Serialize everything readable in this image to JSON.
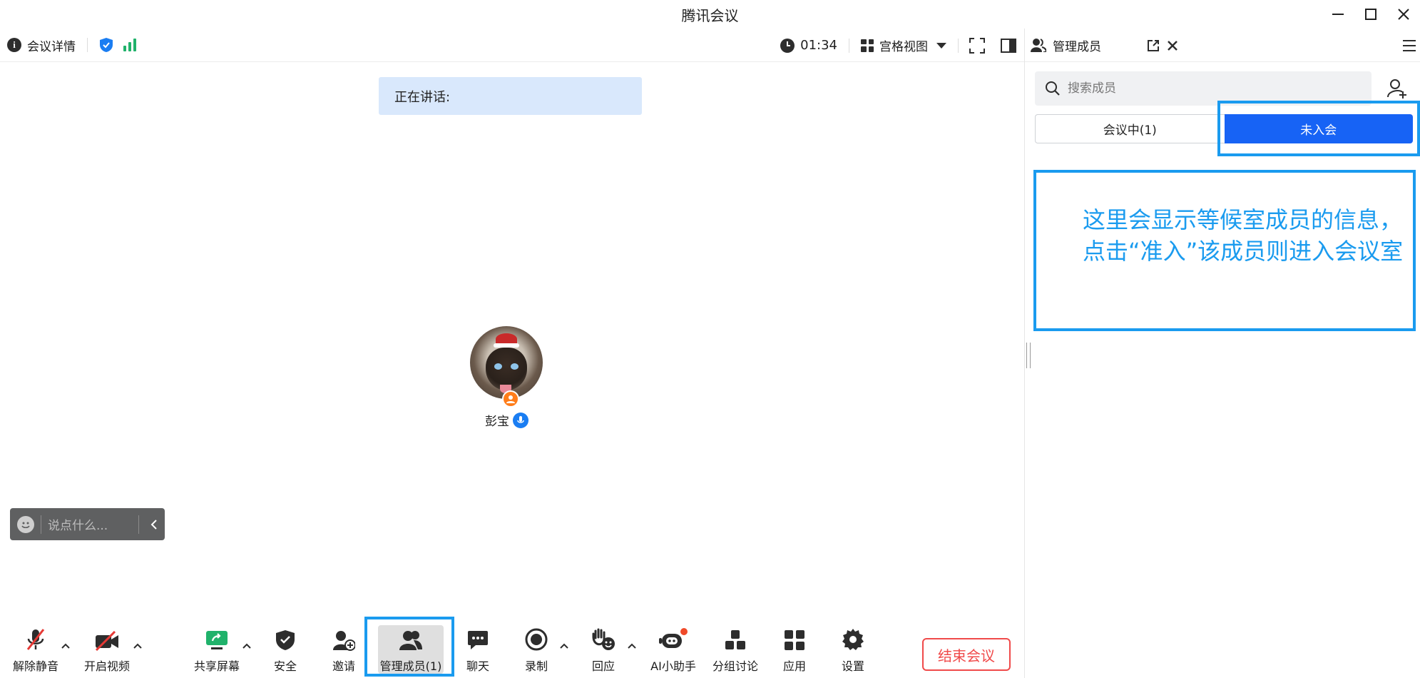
{
  "window": {
    "title": "腾讯会议"
  },
  "topbar": {
    "meeting_details": "会议详情",
    "timer": "01:34",
    "view_mode": "宫格视图"
  },
  "stage": {
    "speaking_label": "正在讲话:",
    "participant_name": "彭宝"
  },
  "chat": {
    "placeholder": "说点什么..."
  },
  "toolbar": {
    "unmute": "解除静音",
    "start_video": "开启视频",
    "share_screen": "共享屏幕",
    "security": "安全",
    "invite": "邀请",
    "manage_members": "管理成员(1)",
    "chat": "聊天",
    "record": "录制",
    "react": "回应",
    "ai_assistant": "AI小助手",
    "breakout": "分组讨论",
    "apps": "应用",
    "settings": "设置",
    "end_meeting": "结束会议"
  },
  "panel": {
    "title": "管理成员",
    "search_placeholder": "搜索成员",
    "tab_in_meeting": "会议中(1)",
    "tab_not_joined": "未入会",
    "annotation": "这里会显示等候室成员的信息，点击“准入”该成员则进入会议室"
  },
  "colors": {
    "accent": "#1763f5",
    "annotation": "#1a9bef",
    "end": "#f04a4a",
    "signal": "#20b26b"
  },
  "icons": [
    "info-icon",
    "shield-icon",
    "signal-icon",
    "clock-icon",
    "grid-view-icon",
    "fullscreen-icon",
    "sidebar-icon",
    "members-icon",
    "popout-icon",
    "close-icon",
    "menu-icon",
    "search-icon",
    "add-member-icon",
    "mic-off-icon",
    "video-off-icon",
    "share-screen-icon",
    "security-icon",
    "invite-icon",
    "chat-icon",
    "record-icon",
    "react-icon",
    "ai-icon",
    "breakout-icon",
    "apps-icon",
    "settings-icon"
  ]
}
